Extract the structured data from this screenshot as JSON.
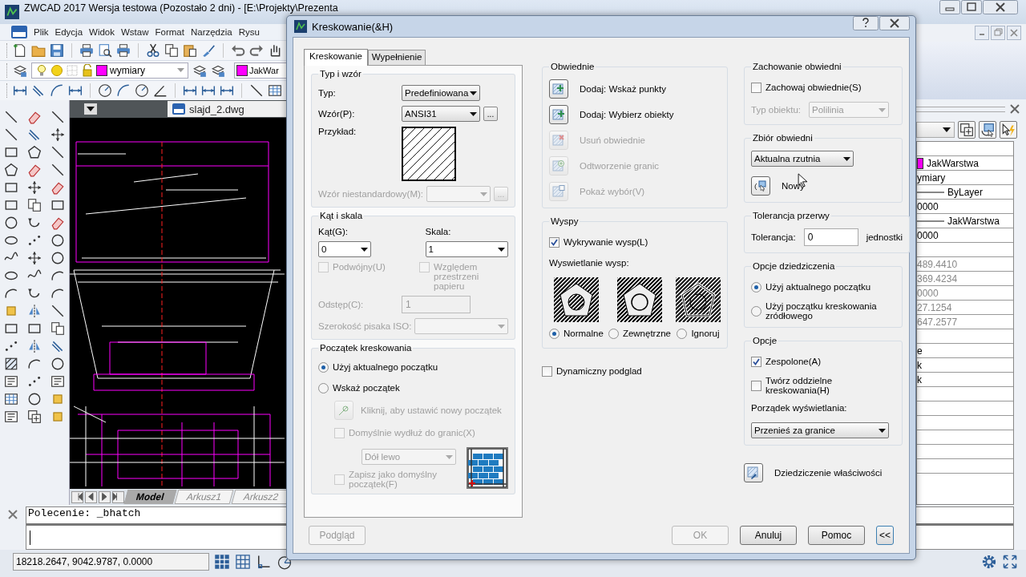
{
  "app": {
    "title": "ZWCAD 2017 Wersja testowa (Pozostało 2 dni) - [E:\\Projekty\\Prezenta",
    "menu": [
      "Plik",
      "Edycja",
      "Widok",
      "Wstaw",
      "Format",
      "Narzędzia",
      "Rysu"
    ],
    "layer_combo": {
      "value": "wymiary",
      "color": "#ff00ff"
    },
    "color_combo": {
      "value": "JakWar",
      "color": "#ff00ff"
    },
    "doc_tab": "slajd_2.dwg",
    "layout_tabs": [
      {
        "label": "Model",
        "selected": true
      },
      {
        "label": "Arkusz1",
        "selected": false
      },
      {
        "label": "Arkusz2",
        "selected": false
      }
    ],
    "command_history": "Polecenie: _bhatch",
    "coordinates": "18218.2647, 9042.9787, 0.0000",
    "properties": [
      {
        "kind": "blank"
      },
      {
        "kind": "swatch",
        "value": "JakWarstwa",
        "color": "#ff00ff",
        "disabled": false
      },
      {
        "kind": "text",
        "value": "ymiary",
        "disabled": false
      },
      {
        "kind": "line",
        "value": "ByLayer",
        "disabled": false
      },
      {
        "kind": "text",
        "value": "0000",
        "disabled": false
      },
      {
        "kind": "line",
        "value": "JakWarstwa",
        "disabled": false
      },
      {
        "kind": "text",
        "value": "0000",
        "disabled": false
      },
      {
        "kind": "blank"
      },
      {
        "kind": "text",
        "value": "489.4410",
        "disabled": true
      },
      {
        "kind": "text",
        "value": "369.4234",
        "disabled": true
      },
      {
        "kind": "text",
        "value": "0000",
        "disabled": true
      },
      {
        "kind": "text",
        "value": "27.1254",
        "disabled": true
      },
      {
        "kind": "text",
        "value": "647.2577",
        "disabled": true
      },
      {
        "kind": "blank"
      },
      {
        "kind": "text",
        "value": "e",
        "disabled": false
      },
      {
        "kind": "text",
        "value": "k",
        "disabled": false
      },
      {
        "kind": "text",
        "value": "k",
        "disabled": false
      },
      {
        "kind": "blank"
      },
      {
        "kind": "blank"
      },
      {
        "kind": "blank"
      },
      {
        "kind": "blank"
      },
      {
        "kind": "blank"
      },
      {
        "kind": "blank"
      }
    ]
  },
  "dialog": {
    "title": "Kreskowanie(&H)",
    "tabs": [
      {
        "label": "Kreskowanie",
        "selected": true
      },
      {
        "label": "Wypełnienie",
        "selected": false
      }
    ],
    "left": [
      {
        "title": "Typ i wzór",
        "rows": [
          {
            "kind": "select",
            "label": "Typ:",
            "value": "Predefiniowana",
            "disabled": false
          },
          {
            "kind": "select",
            "label": "Wzór(P):",
            "value": "ANSI31",
            "disabled": false,
            "button": "..."
          },
          {
            "kind": "sample",
            "label": "Przykład:"
          },
          {
            "kind": "select",
            "label": "Wzór niestandardowy(M):",
            "disabled": true,
            "button": "..."
          }
        ]
      },
      {
        "title": "Kąt i skala",
        "rows": [
          {
            "kind": "columns",
            "items": [
              {
                "kind": "stacked_select",
                "label": "Kąt(G):",
                "value": "0",
                "disabled": false
              },
              {
                "kind": "stacked_select",
                "label": "Skala:",
                "value": "1",
                "disabled": false
              }
            ]
          },
          {
            "kind": "columns",
            "items": [
              {
                "kind": "check",
                "label": "Podwójny(U)",
                "checked": false,
                "disabled": true
              },
              {
                "kind": "check",
                "label": "Względem przestrzeni papieru",
                "checked": false,
                "disabled": true
              }
            ]
          },
          {
            "kind": "input",
            "label": "Odstęp(C):",
            "value": "1",
            "disabled": true
          },
          {
            "kind": "select",
            "label": "Szerokość pisaka ISO:",
            "disabled": true
          }
        ]
      },
      {
        "title": "Początek kreskowania",
        "rows": [
          {
            "kind": "radio",
            "label": "Użyj aktualnego początku",
            "selected": true,
            "disabled": false
          },
          {
            "kind": "radio",
            "label": "Wskaż początek",
            "selected": false,
            "disabled": false,
            "children": [
              {
                "kind": "action",
                "label": "Kliknij, aby ustawić nowy początek",
                "disabled": true
              },
              {
                "kind": "check",
                "label": "Domyślnie wydłuż do granic(X)",
                "checked": false,
                "disabled": true
              },
              {
                "kind": "with_icon",
                "items": [
                  {
                    "kind": "select",
                    "value": "Dół lewo",
                    "disabled": true
                  },
                  {
                    "kind": "check",
                    "label": "Zapisz jako domyślny początek(F)",
                    "checked": false,
                    "disabled": true
                  }
                ]
              }
            ]
          }
        ]
      }
    ],
    "middle": [
      {
        "title": "Obwiednie",
        "rows": [
          {
            "kind": "action",
            "label": "Dodaj: Wskaż punkty",
            "disabled": false
          },
          {
            "kind": "action",
            "label": "Dodaj: Wybierz obiekty",
            "disabled": false
          },
          {
            "kind": "action",
            "label": "Usuń obwiednie",
            "disabled": true
          },
          {
            "kind": "action",
            "label": "Odtworzenie granic",
            "disabled": true
          },
          {
            "kind": "action",
            "label": "Pokaż wybór(V)",
            "disabled": true
          }
        ]
      },
      {
        "title": "Wyspy",
        "rows": [
          {
            "kind": "check",
            "label": "Wykrywanie wysp(L)",
            "checked": true,
            "disabled": false
          },
          {
            "kind": "caption",
            "label": "Wyswietlanie wysp:"
          },
          {
            "kind": "islands",
            "options": [
              {
                "label": "Normalne",
                "selected": true
              },
              {
                "label": "Zewnętrzne",
                "selected": false
              },
              {
                "label": "Ignoruj",
                "selected": false
              }
            ]
          }
        ]
      },
      {
        "rows": [
          {
            "kind": "check",
            "label": "Dynamiczny podglad",
            "checked": false,
            "disabled": false
          }
        ]
      }
    ],
    "right": [
      {
        "title": "Zachowanie obwiedni",
        "rows": [
          {
            "kind": "check",
            "label": "Zachowaj obwiednie(S)",
            "checked": false,
            "disabled": false
          },
          {
            "kind": "select",
            "label": "Typ obiektu:",
            "value": "Polilinia",
            "disabled": true
          }
        ]
      },
      {
        "title": "Zbiór obwiedni",
        "rows": [
          {
            "kind": "select",
            "value": "Aktualna rzutnia",
            "disabled": false
          },
          {
            "kind": "action",
            "label": "Nowy",
            "disabled": false
          }
        ]
      },
      {
        "title": "Tolerancja przerwy",
        "rows": [
          {
            "kind": "input",
            "label": "Tolerancja:",
            "value": "0",
            "suffix": "jednostki",
            "disabled": false
          }
        ]
      },
      {
        "title": "Opcje dziedziczenia",
        "rows": [
          {
            "kind": "radio",
            "label": "Użyj aktualnego początku",
            "selected": true,
            "disabled": false
          },
          {
            "kind": "radio",
            "label": "Użyj początku kreskowania zródłowego",
            "selected": false,
            "disabled": false
          }
        ]
      },
      {
        "title": "Opcje",
        "rows": [
          {
            "kind": "check",
            "label": "Zespolone(A)",
            "checked": true,
            "disabled": false
          },
          {
            "kind": "check",
            "label": "Twórz oddzielne kreskowania(H)",
            "checked": false,
            "disabled": false
          },
          {
            "kind": "caption",
            "label": "Porządek wyświetlania:"
          },
          {
            "kind": "select",
            "value": "Przenieś za granice",
            "disabled": false
          }
        ]
      },
      {
        "rows": [
          {
            "kind": "action",
            "label": "Dziedziczenie właściwości",
            "disabled": false
          }
        ]
      }
    ],
    "buttons": [
      {
        "label": "Podgląd",
        "disabled": true
      },
      {
        "label": "OK",
        "disabled": true
      },
      {
        "label": "Anuluj",
        "disabled": false
      },
      {
        "label": "Pomoc",
        "disabled": false
      },
      {
        "label": "<<",
        "disabled": false
      }
    ]
  }
}
